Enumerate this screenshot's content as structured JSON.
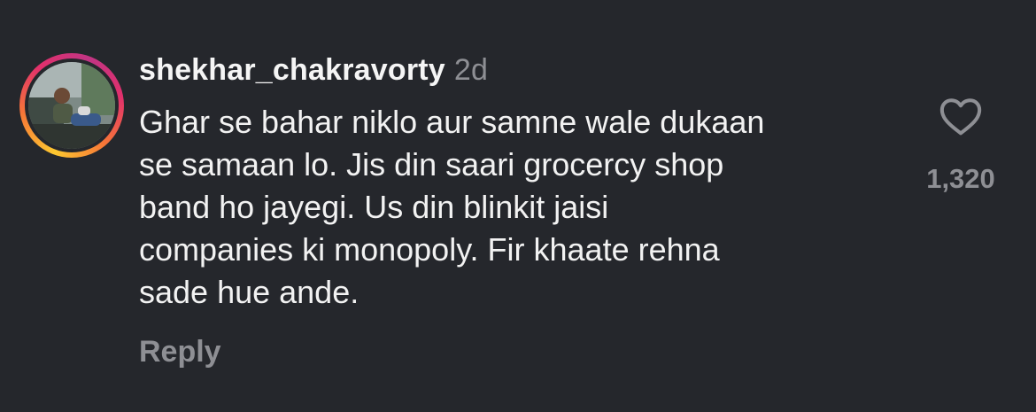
{
  "comment": {
    "username": "shekhar_chakravorty",
    "timestamp": "2d",
    "text_lines": [
      "Ghar se bahar niklo aur samne wale dukaan",
      "se samaan lo. Jis din saari grocercy shop",
      "band ho jayegi. Us din blinkit jaisi",
      "companies ki monopoly. Fir khaate rehna",
      "sade hue ande."
    ],
    "reply_label": "Reply",
    "like_count": "1,320",
    "like_icon": "heart-outline-icon"
  },
  "colors": {
    "background": "#25272c",
    "primary_text": "#f2f2f2",
    "secondary_text": "#8e8f94",
    "story_ring_gradient": [
      "#fdc830",
      "#f77737",
      "#e1306c",
      "#c13584"
    ]
  }
}
